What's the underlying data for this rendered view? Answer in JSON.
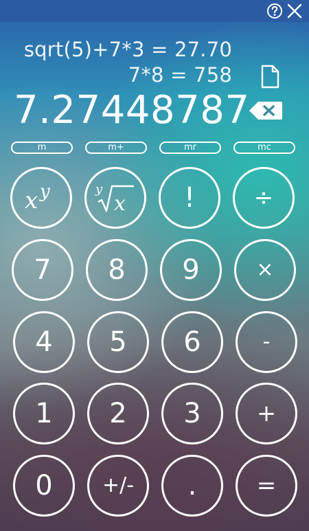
{
  "titlebar": {
    "help_icon": "help-circle-icon",
    "close_icon": "close-icon"
  },
  "history": [
    "sqrt(5)+7*3 = 27.70",
    "7*8 = 758"
  ],
  "display": {
    "value": "7.27448787"
  },
  "icons": {
    "history_file": "file-icon",
    "backspace": "backspace-icon"
  },
  "memory": {
    "m": "m",
    "m_plus": "m+",
    "mr": "mr",
    "mc": "mc"
  },
  "keys": {
    "power": "xʸ",
    "root": "ʸ√x",
    "factorial": "!",
    "divide": "÷",
    "seven": "7",
    "eight": "8",
    "nine": "9",
    "multiply": "×",
    "four": "4",
    "five": "5",
    "six": "6",
    "minus": "-",
    "one": "1",
    "two": "2",
    "three": "3",
    "plus": "+",
    "zero": "0",
    "sign": "+/-",
    "decimal": ".",
    "equals": "="
  },
  "colors": {
    "titlebar": "#2a5ba3",
    "foreground": "#ffffff"
  }
}
